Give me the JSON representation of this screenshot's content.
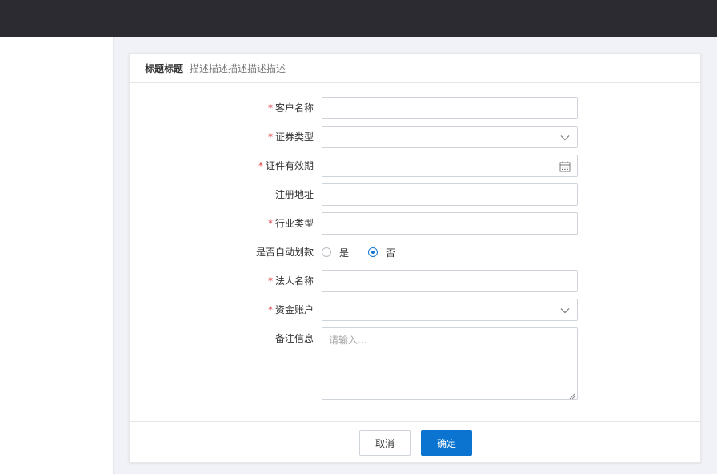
{
  "header": {
    "title": "标题标题",
    "description": "描述描述描述描述描述"
  },
  "form": {
    "customer_name": {
      "label": "客户名称",
      "required": true,
      "value": ""
    },
    "security_type": {
      "label": "证券类型",
      "required": true,
      "value": "",
      "icon": "chevron-down-icon"
    },
    "id_validity": {
      "label": "证件有效期",
      "required": true,
      "value": "",
      "icon": "calendar-icon"
    },
    "registered_address": {
      "label": "注册地址",
      "required": false,
      "value": ""
    },
    "industry_type": {
      "label": "行业类型",
      "required": true,
      "value": ""
    },
    "auto_debit": {
      "label": "是否自动划款",
      "required": false,
      "options": [
        "是",
        "否"
      ],
      "selected": "否"
    },
    "legal_person_name": {
      "label": "法人名称",
      "required": true,
      "value": ""
    },
    "fund_account": {
      "label": "资金账户",
      "required": true,
      "value": "",
      "icon": "chevron-down-icon"
    },
    "remarks": {
      "label": "备注信息",
      "required": false,
      "placeholder": "请输入..."
    }
  },
  "footer": {
    "cancel_label": "取消",
    "confirm_label": "确定"
  },
  "required_mark": "*",
  "colors": {
    "topbar": "#2b2b31",
    "primary": "#0b73d0",
    "required": "#e0393e",
    "page_bg": "#f0f2f8"
  }
}
